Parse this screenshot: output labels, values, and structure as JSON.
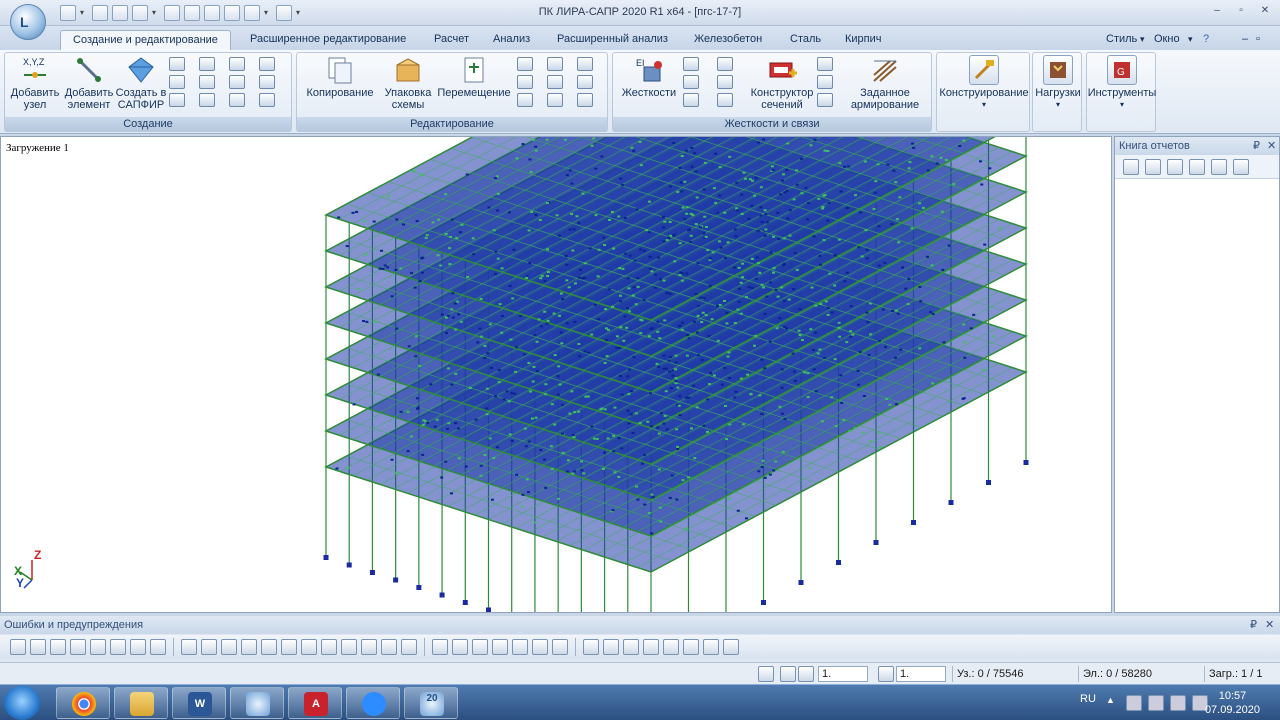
{
  "window": {
    "title": "ПК ЛИРА-САПР  2020 R1 x64 - [пгс-17-7]",
    "app_logo_text": "L",
    "controls": [
      "–",
      "▫",
      "✕"
    ]
  },
  "ribbon_tabs": {
    "items": [
      "Создание и редактирование",
      "Расширенное редактирование",
      "Расчет",
      "Анализ",
      "Расширенный анализ",
      "Железобетон",
      "Сталь",
      "Кирпич"
    ],
    "right": [
      "Стиль",
      "Окно",
      "?"
    ]
  },
  "ribbon": {
    "create": {
      "label": "Создание",
      "buttons": [
        {
          "label": "Добавить\nузел",
          "icon": "add-node-icon"
        },
        {
          "label": "Добавить\nэлемент",
          "icon": "add-element-icon"
        },
        {
          "label": "Создать в\nСАПФИР",
          "icon": "sapfir-icon"
        }
      ]
    },
    "edit": {
      "label": "Редактирование",
      "buttons": [
        {
          "label": "Копирование",
          "icon": "copy-icon"
        },
        {
          "label": "Упаковка\nсхемы",
          "icon": "pack-icon"
        },
        {
          "label": "Перемещение",
          "icon": "move-icon"
        }
      ]
    },
    "stiff": {
      "label": "Жесткости и связи",
      "buttons": [
        {
          "label": "Жесткости",
          "icon": "stiffness-icon"
        },
        {
          "label": "Конструктор\nсечений",
          "icon": "section-builder-icon"
        },
        {
          "label": "Заданное\nармирование",
          "icon": "reinforcement-icon"
        }
      ]
    },
    "solo": [
      {
        "label": "Конструирование",
        "icon": "design-icon"
      },
      {
        "label": "Нагрузки",
        "icon": "loads-icon"
      },
      {
        "label": "Инструменты",
        "icon": "tools-icon"
      }
    ]
  },
  "canvas": {
    "label": "Загружение 1",
    "axes": {
      "x": "X",
      "y": "Y",
      "z": "Z"
    }
  },
  "right_panel": {
    "title": "Книга отчетов",
    "pin": "₽",
    "close": "✕"
  },
  "bottom_panel": {
    "title": "Ошибки и предупреждения",
    "pin": "₽",
    "close": "✕"
  },
  "status": {
    "field1": "1.",
    "field2": "1.",
    "nodes": "Уз.: 0 / 75546",
    "elements": "Эл.: 0 / 58280",
    "load": "Загр.: 1 / 1"
  },
  "taskbar": {
    "lang": "RU",
    "time": "10:57",
    "date": "07.09.2020",
    "apps": [
      "chrome",
      "explorer",
      "word",
      "lira",
      "autocad",
      "zoom",
      "lira20"
    ],
    "lira20_label": "20"
  },
  "colors": {
    "structure_blue": "#1a3ab0",
    "structure_green": "#2e8b3a",
    "accent": "#15315a"
  }
}
